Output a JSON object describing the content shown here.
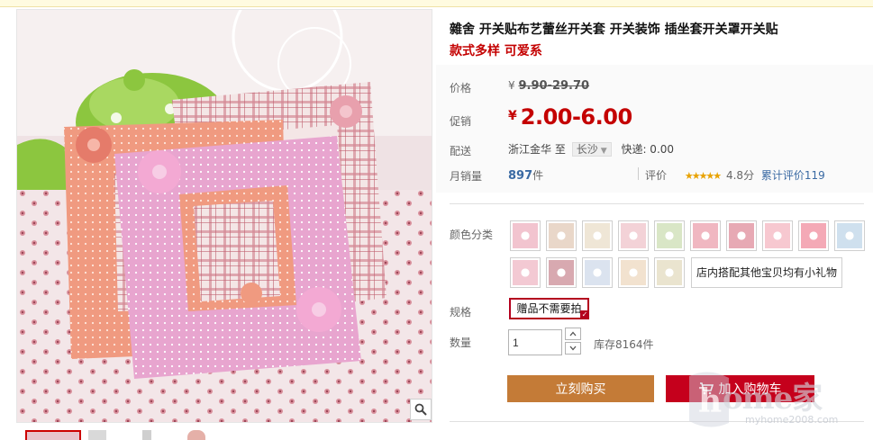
{
  "product": {
    "title": "雜舍 开关贴布艺蕾丝开关套 开关装饰 插坐套开关罩开关贴",
    "subtitle": "款式多样 可爱系"
  },
  "price": {
    "label": "价格",
    "currency": "¥",
    "original": "9.90-29.70"
  },
  "promo": {
    "label": "促销",
    "currency": "¥",
    "price": "2.00-6.00"
  },
  "shipping": {
    "label": "配送",
    "from": "浙江金华",
    "to_word": "至",
    "destination": "长沙",
    "fee": "快递: 0.00"
  },
  "sales": {
    "label": "月销量",
    "count": "897",
    "unit": "件",
    "review_label": "评价",
    "stars": "★★★★★",
    "score": "4.8分",
    "review_link": "累计评价119"
  },
  "color": {
    "label": "颜色分类",
    "swatches": [
      {
        "name": "swatch-1",
        "color": "#f2c4cf"
      },
      {
        "name": "swatch-2",
        "color": "#e9d7c9"
      },
      {
        "name": "swatch-3",
        "color": "#efe6d6"
      },
      {
        "name": "swatch-4",
        "color": "#f3d2d7"
      },
      {
        "name": "swatch-5",
        "color": "#d9e6c6"
      },
      {
        "name": "swatch-6",
        "color": "#f0b7c1"
      },
      {
        "name": "swatch-7",
        "color": "#e7a9b4"
      },
      {
        "name": "swatch-8",
        "color": "#f7c8d0"
      },
      {
        "name": "swatch-9",
        "color": "#f4a9b6"
      },
      {
        "name": "swatch-10",
        "color": "#cfe0ee"
      },
      {
        "name": "swatch-11",
        "color": "#f3c9d3"
      },
      {
        "name": "swatch-12",
        "color": "#d8a9b0"
      },
      {
        "name": "swatch-13",
        "color": "#dbe3ef"
      },
      {
        "name": "swatch-14",
        "color": "#f2e2cf"
      },
      {
        "name": "swatch-15",
        "color": "#eae4cf"
      }
    ],
    "text_option": "店内搭配其他宝贝均有小礼物"
  },
  "spec": {
    "label": "规格",
    "option": "赠品不需要拍"
  },
  "quantity": {
    "label": "数量",
    "value": "1",
    "stock": "库存8164件"
  },
  "buttons": {
    "buy": "立刻购买",
    "cart": "加入购物车"
  },
  "watermark": {
    "main": "ome家",
    "sub": "myhome2008.com"
  },
  "colors": {
    "accent_red": "#c40000",
    "buy_button": "#c47b37",
    "cart_button": "#c5001c"
  }
}
